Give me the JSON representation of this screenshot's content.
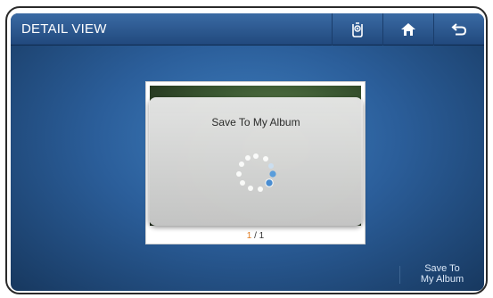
{
  "header": {
    "title": "DETAIL VIEW",
    "buttons": [
      {
        "icon": "hand-badge-icon"
      },
      {
        "icon": "home-icon"
      },
      {
        "icon": "back-arrow-icon"
      }
    ]
  },
  "viewer": {
    "current_page": "1",
    "separator": " / ",
    "total_pages": "1"
  },
  "dialog": {
    "title": "Save To My Album"
  },
  "footer": {
    "save_line1": "Save To",
    "save_line2": "My Album"
  },
  "colors": {
    "accent_page": "#e07a1f",
    "topbar": "#2a5a92"
  }
}
